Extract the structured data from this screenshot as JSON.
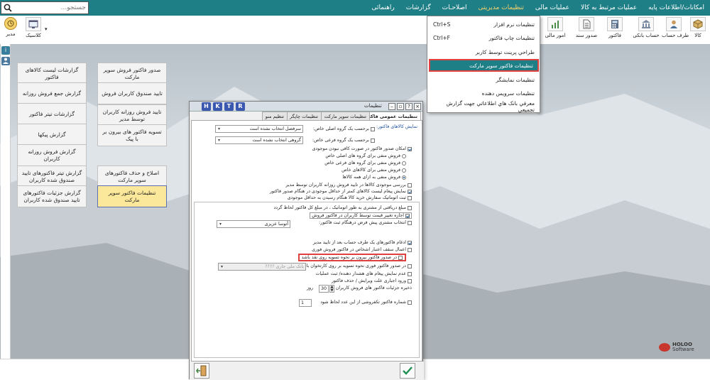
{
  "menu": {
    "items": [
      {
        "label": "امکانات/اطلاعات پایه",
        "active": false
      },
      {
        "label": "عملیات مرتبط به کالا",
        "active": false
      },
      {
        "label": "عملیات مالی",
        "active": false
      },
      {
        "label": "تنظیمات مدیریتی",
        "active": true
      },
      {
        "label": "اصلاحـات",
        "active": false
      },
      {
        "label": "گزارشات",
        "active": false
      },
      {
        "label": "راهنمائی",
        "active": false
      }
    ],
    "accent_color": "#1f7f86",
    "active_color": "#f7d26a"
  },
  "search": {
    "placeholder": "جستجو...",
    "icon": "search-icon"
  },
  "toolbar": {
    "right_items": [
      {
        "label": "کالا",
        "icon": "box-icon"
      },
      {
        "label": "طرف حساب",
        "icon": "person-icon"
      },
      {
        "label": "حساب بانکی",
        "icon": "bank-icon"
      },
      {
        "label": "فاکتور",
        "icon": "calculator-icon"
      },
      {
        "label": "صدور سند",
        "icon": "document-icon"
      },
      {
        "label": "امور مالی",
        "icon": "finance-icon"
      }
    ],
    "left_items": [
      {
        "label": "مدیر",
        "icon": "clock-icon"
      },
      {
        "label": "کلاسیک",
        "icon": "theme-icon"
      }
    ]
  },
  "sidebar": {
    "icons": [
      "info-icon",
      "user-icon"
    ]
  },
  "dropdown": {
    "items": [
      {
        "label": "تنظیمات نرم افزار",
        "shortcut": "Ctrl+S",
        "highlighted": false
      },
      {
        "label": "تنظیمات چاپ فاکتور",
        "shortcut": "Ctrl+F",
        "highlighted": false
      },
      {
        "label": "طراحي پرينت توسط کاربر",
        "shortcut": "",
        "highlighted": false
      },
      {
        "label": "تنظیمات فاکتور سوپر مارکت",
        "shortcut": "",
        "highlighted": true
      },
      {
        "label": "تنظیمات نمایشگر",
        "shortcut": "",
        "highlighted": false
      },
      {
        "label": "تنظیمات سرویس دهنده",
        "shortcut": "",
        "highlighted": false
      },
      {
        "label": "معرفي بانک هاي اطلاعاتي جهت گزارش تجميعي",
        "shortcut": "",
        "highlighted": false
      }
    ]
  },
  "tiles": {
    "col1": [
      "صدور فاکتور فروش سوپر مارکت",
      "تایید صندوق کاربران فروش",
      "تایید فروش روزانه کاربران توسط مدیر",
      "تسویه فاکتور های بیرون بر با پیک",
      "اصلاح و حذف فاکتورهای سوپر مارکت",
      "تنظیمات فاکتور سوپر مارکت"
    ],
    "col2": [
      "گزارشات لیست کالاهای فاکتور",
      "گزارش جمع فروش روزانه",
      "گزارشات تیتر فاکتور",
      "گزارش پیکها",
      "گزارش فروش روزانه کاربران",
      "گزارش تیتر فاکتورهای تایید صندوق شده کاربران",
      "گزارش جزئیات فاکتورهای تایید صندوق شده کاربران"
    ],
    "selected_color": "#fce89a"
  },
  "dialog": {
    "title": "تنظیمات",
    "hotkeys": [
      "H",
      "K",
      "T",
      "R"
    ],
    "tabs": [
      "تنظیمات عمومی فاکتور",
      "تنظیمات سوپر مارکت",
      "تنظیمات چاپگر",
      "تنظیم منو"
    ],
    "group_title": "نمایش کالاهای فاکتور:",
    "filter_main_label": "برحسب یک گروه اصلی خاص:",
    "filter_main_value": "سرفصل انتخاب نشده است",
    "filter_sub_label": "برحسب یک گروه فرعی خاص:",
    "filter_sub_value": "گروهی انتخاب نشده است",
    "allow_no_stock": "امکان صدور فاکتور در صورت کافی نبودن موجودی",
    "radio_options": [
      "فروش منفی برای گروه های اصلی خاص",
      "فروش منفی برای گروه های فرعی خاص",
      "فروش منفی برای کالاهای خاص",
      "فروش منفی به ازای همه کالاها"
    ],
    "checks_a": [
      "بررسی موجودی کالاها در تایید فروش روزانه کاربران توسط مدیر",
      "نمایش پیغام لیست کالاهای کمتر از حداقل موجودی در هنگام صدور فاکتور",
      "ثبت اتوماتیک سفارش خرید کالا هنگام رسیدن به حداقل موجودی"
    ],
    "receive_amount": "مبلغ دریافتی از مشتری به طور اتوماتیک ، در مبلغ کل فاکتور لحاظ گردد",
    "allow_price_change": "اجازه تغییر قیمت توسط کاربران در فاکتور فروش",
    "default_customer_label": "انتخاب مشتری پیش فرض درهنگام ثبت فاکتور:",
    "default_customer_value": "آتوسا عزیزی",
    "checks_b": [
      "ادغام فاکتورهای یک طرف حساب بعد از تایید مدیر",
      "اعمال سقف اعتبار اشخاص در فاکتور فروش فوری"
    ],
    "outgoing_settlement": "در صدور فاکتور بیرون بر نحوه تسویه روی نقد باشد",
    "quick_invoice_label": "در صدور فاکتور فوری نحوه تسویه بر روی کارتخوان باشد",
    "quick_invoice_value": "بانک ملی جاری ????",
    "no_warning": "عدم نمایش پیغام های هشدار دهنده/ ثبت عملیات",
    "cancel_reason": "ورود اجباری علت ویرایش / حذف فاکتور",
    "keep_details_label": "ذخیره جزئیات فاکتور های فروش کاربران تا",
    "keep_details_value": "30",
    "keep_details_unit": "روز",
    "rounding_label": "شماره فاکتور تکفروشی از این عدد لحاظ شود",
    "rounding_value": "1"
  },
  "brand": {
    "name": "HOLOO",
    "sub": "Software",
    "color": "#c8372d"
  }
}
